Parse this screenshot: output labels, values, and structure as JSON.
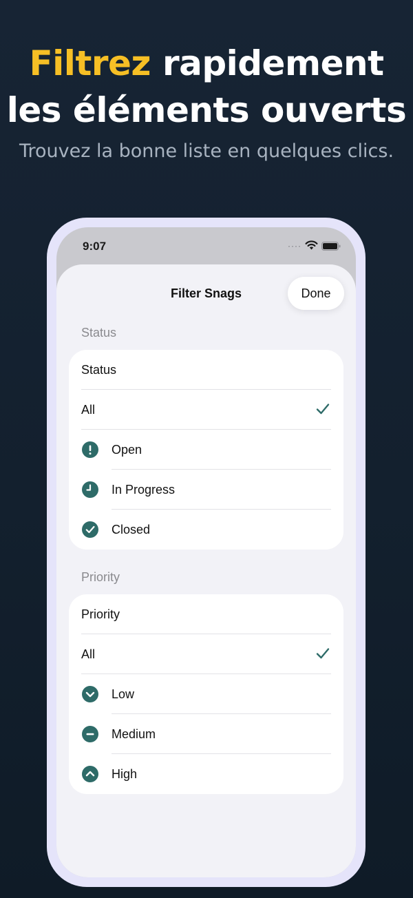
{
  "hero": {
    "title_accent": "Filtrez",
    "title_rest": " rapidement",
    "title_line2": "les éléments ouverts",
    "subtitle": "Trouvez la bonne liste en quelques clics."
  },
  "status_bar": {
    "time": "9:07",
    "dots": "····"
  },
  "sheet": {
    "title": "Filter Snags",
    "done_label": "Done"
  },
  "status_section": {
    "header": "Status",
    "title_row": "Status",
    "all_label": "All",
    "options": [
      {
        "label": "Open",
        "icon": "exclamation-circle-icon"
      },
      {
        "label": "In Progress",
        "icon": "clock-icon"
      },
      {
        "label": "Closed",
        "icon": "check-circle-icon"
      }
    ]
  },
  "priority_section": {
    "header": "Priority",
    "title_row": "Priority",
    "all_label": "All",
    "options": [
      {
        "label": "Low",
        "icon": "chevron-down-circle-icon"
      },
      {
        "label": "Medium",
        "icon": "minus-circle-icon"
      },
      {
        "label": "High",
        "icon": "chevron-up-circle-icon"
      }
    ]
  },
  "colors": {
    "accent_yellow": "#f6bf25",
    "icon_teal": "#2e6b68",
    "background": "#152230",
    "phone_frame": "#e5e4fa"
  }
}
